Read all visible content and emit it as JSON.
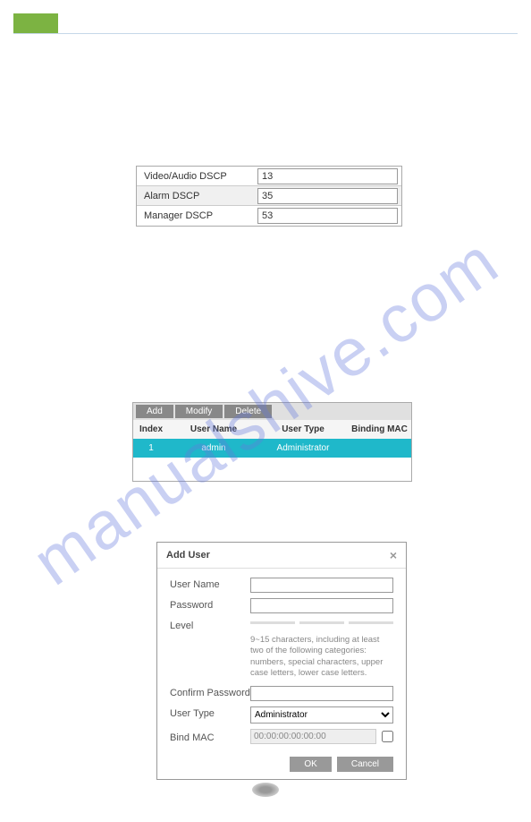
{
  "dscp": {
    "rows": [
      {
        "label": "Video/Audio DSCP",
        "value": "13"
      },
      {
        "label": "Alarm DSCP",
        "value": "35"
      },
      {
        "label": "Manager DSCP",
        "value": "53"
      }
    ]
  },
  "userTable": {
    "toolbar": {
      "add": "Add",
      "modify": "Modify",
      "delete": "Delete"
    },
    "headers": {
      "index": "Index",
      "name": "User Name",
      "type": "User Type",
      "mac": "Binding MAC"
    },
    "row": {
      "index": "1",
      "name": "admin",
      "type": "Administrator",
      "mac": ""
    }
  },
  "dialog": {
    "title": "Add User",
    "labels": {
      "username": "User Name",
      "password": "Password",
      "level": "Level",
      "confirm": "Confirm Password",
      "usertype": "User Type",
      "bindmac": "Bind MAC"
    },
    "hint": "9~15 characters, including at least two of the following categories: numbers, special characters, upper case letters, lower case letters.",
    "usertype_value": "Administrator",
    "mac_value": "00:00:00:00:00:00",
    "buttons": {
      "ok": "OK",
      "cancel": "Cancel"
    }
  },
  "watermark": "manualshive.com"
}
